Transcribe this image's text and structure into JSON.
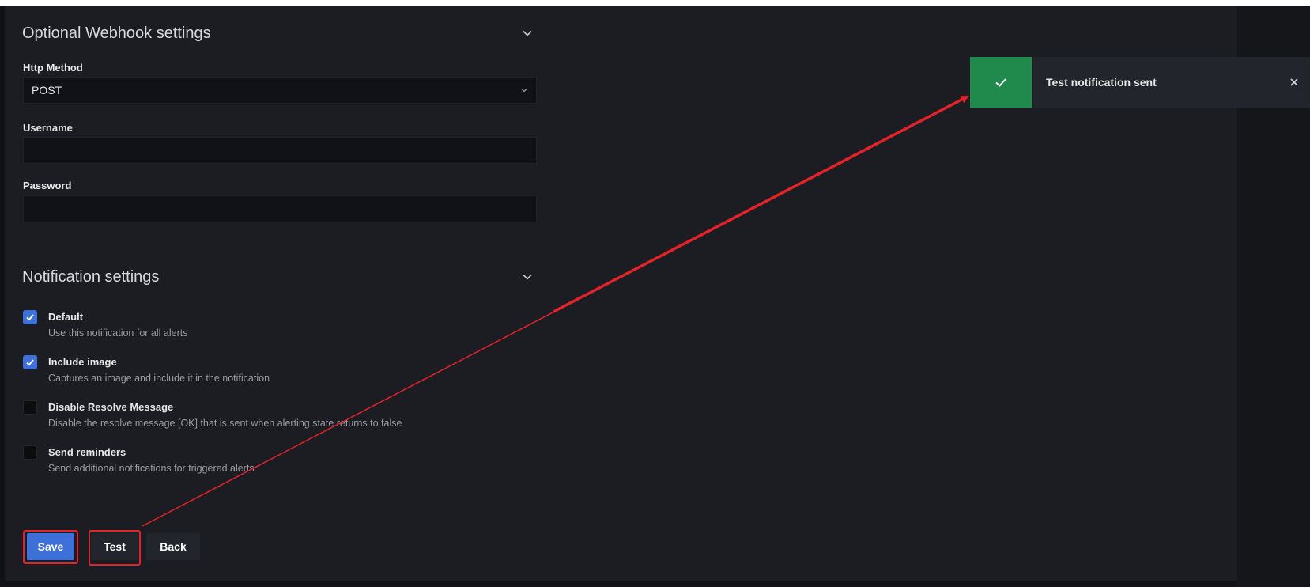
{
  "webhook_section": {
    "title": "Optional Webhook settings",
    "http_method": {
      "label": "Http Method",
      "value": "POST"
    },
    "username": {
      "label": "Username",
      "value": ""
    },
    "password": {
      "label": "Password",
      "value": ""
    }
  },
  "notification_section": {
    "title": "Notification settings",
    "options": [
      {
        "label": "Default",
        "description": "Use this notification for all alerts",
        "checked": true
      },
      {
        "label": "Include image",
        "description": "Captures an image and include it in the notification",
        "checked": true
      },
      {
        "label": "Disable Resolve Message",
        "description": "Disable the resolve message [OK] that is sent when alerting state returns to false",
        "checked": false
      },
      {
        "label": "Send reminders",
        "description": "Send additional notifications for triggered alerts",
        "checked": false
      }
    ]
  },
  "actions": {
    "save_label": "Save",
    "test_label": "Test",
    "back_label": "Back"
  },
  "toast": {
    "message": "Test notification sent",
    "status": "success"
  },
  "colors": {
    "primary": "#3d71d9",
    "success": "#1f8a4c",
    "annotation": "#e5222a",
    "panel": "#1b1d22"
  },
  "icons": {
    "section_toggle": "chevron-down-icon",
    "select_caret": "chevron-down-icon",
    "checkbox_check": "check-icon",
    "toast_status": "check-icon",
    "toast_close": "close-icon"
  }
}
